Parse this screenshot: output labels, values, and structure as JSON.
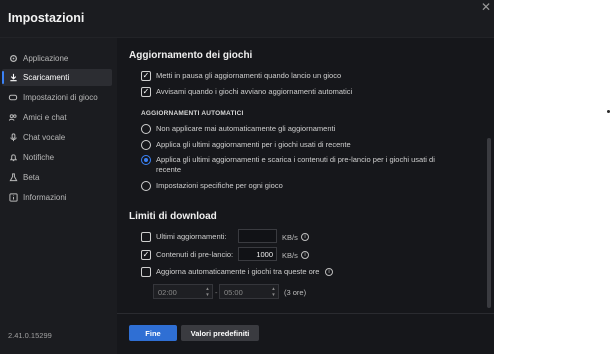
{
  "window": {
    "title": "Impostazioni",
    "close_glyph": "✕"
  },
  "sidebar": {
    "items": [
      {
        "label": "Applicazione",
        "icon": "gear-icon"
      },
      {
        "label": "Scaricamenti",
        "icon": "download-icon",
        "active": true
      },
      {
        "label": "Impostazioni di gioco",
        "icon": "gamepad-icon"
      },
      {
        "label": "Amici e chat",
        "icon": "friends-icon"
      },
      {
        "label": "Chat vocale",
        "icon": "microphone-icon"
      },
      {
        "label": "Notifiche",
        "icon": "bell-icon"
      },
      {
        "label": "Beta",
        "icon": "flask-icon"
      },
      {
        "label": "Informazioni",
        "icon": "info-icon"
      }
    ],
    "version": "2.41.0.15299"
  },
  "updates": {
    "heading": "Aggiornamento dei giochi",
    "pause_label": "Metti in pausa gli aggiornamenti quando lancio un gioco",
    "pause_checked": true,
    "notify_label": "Avvisami quando i giochi avviano aggiornamenti automatici",
    "notify_checked": true,
    "auto_heading": "AGGIORNAMENTI AUTOMATICI",
    "options": [
      {
        "label": "Non applicare mai automaticamente gli aggiornamenti",
        "selected": false
      },
      {
        "label": "Applica gli ultimi aggiornamenti per i giochi usati di recente",
        "selected": false
      },
      {
        "label": "Applica gli ultimi aggiornamenti e scarica i contenuti di pre-lancio per i giochi usati di recente",
        "selected": true
      },
      {
        "label": "Impostazioni specifiche per ogni gioco",
        "selected": false
      }
    ]
  },
  "download": {
    "heading": "Limiti di download",
    "latest_label": "Ultimi aggiornamenti:",
    "latest_value": "",
    "latest_checked": false,
    "prelaunch_label": "Contenuti di pre-lancio:",
    "prelaunch_value": "1000",
    "prelaunch_checked": true,
    "unit": "KB/s",
    "schedule_label": "Aggiorna automaticamente i giochi tra queste ore",
    "schedule_checked": false,
    "time_start": "02:00",
    "time_sep": "-",
    "time_end": "05:00",
    "duration": "(3 ore)"
  },
  "footer": {
    "done_label": "Fine",
    "defaults_label": "Valori predefiniti"
  },
  "colors": {
    "accent": "#3b82f6",
    "background": "#16171b",
    "sidebar": "#1b1c20"
  }
}
